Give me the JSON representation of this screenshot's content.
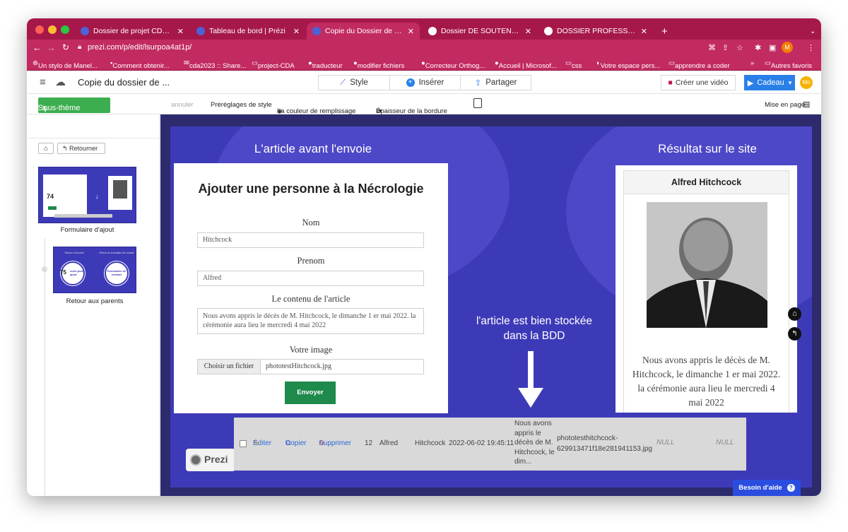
{
  "browser": {
    "tabs": [
      {
        "label": "Dossier de projet CDA bastien",
        "active": false,
        "favicon_color": "#4a63d6"
      },
      {
        "label": "Tableau de bord | Prézi",
        "active": false,
        "favicon_color": "#4a63d6"
      },
      {
        "label": "Copie du Dossier de projet CD:",
        "active": true,
        "favicon_color": "#4a63d6"
      },
      {
        "label": "Dossier DE SOUTENANCE PO",
        "active": false,
        "favicon_color": "#ffffff"
      },
      {
        "label": "DOSSIER PROFESSIONNEL (DI",
        "active": false,
        "favicon_color": "#ffffff"
      }
    ],
    "url": "prezi.com/p/edit/lsurpoa4at1p/",
    "bookmarks": [
      "Un stylo de Manel...",
      "Comment obtenir...",
      "cda2023 :: Share...",
      "project-CDA",
      "traducteur",
      "modifier fichiers",
      "Correcteur Orthog...",
      "Accueil | Microsof...",
      "css",
      "Votre espace pers...",
      "apprendre a coder",
      "»",
      "Autres favoris"
    ],
    "profile_initial": "M"
  },
  "app": {
    "doc_title": "Copie du dossier de ...",
    "style_label": "Style",
    "insert_label": "Insérer",
    "share_label": "Partager",
    "video_label": "Créer une vidéo",
    "gift_label": "Cadeau",
    "user_initials": "Mo"
  },
  "toolbar": {
    "undo": "annuler",
    "presets": "Préréglages de style",
    "fill": "La couleur de remplissage",
    "border": "Épaisseur de la bordure",
    "layout": "Mise en page"
  },
  "sidebar": {
    "add_topic": "Sous-thème",
    "back": "Retourner",
    "topics": [
      {
        "label": "Formulaire d'ajout",
        "number": "74"
      },
      {
        "label": "Retour aux parents",
        "number": "75",
        "thumb_left": "Retour à l'accueil",
        "thumb_left_bubble": "cuirs pour ajout",
        "thumb_right": "Retour au formulaire de contact",
        "thumb_right_bubble": "Formulaire de contact"
      }
    ]
  },
  "slide": {
    "left_title": "L'article avant l'envoie",
    "right_title": "Résultat sur le site",
    "middle_text": "l'article est bien stockée dans la BDD",
    "form": {
      "heading": "Ajouter une personne à la Nécrologie",
      "nom_label": "Nom",
      "nom_value": "Hitchcock",
      "prenom_label": "Prenom",
      "prenom_value": "Alfred",
      "content_label": "Le contenu de l'article",
      "content_value": "Nous avons appris le décès de M. Hitchcock, le dimanche 1 er mai 2022. la cérémonie aura lieu le mercredi 4 mai 2022",
      "image_label": "Votre image",
      "file_button": "Choisir un fichier",
      "file_name": "phototestHitchcock.jpg",
      "submit": "Envoyer"
    },
    "result": {
      "name": "Alfred Hitchcock",
      "text": "Nous avons appris le décès de M. Hitchcock, le dimanche 1 er mai 2022. la cérémonie aura lieu le mercredi 4 mai 2022"
    },
    "db_row": {
      "edit": "Éditer",
      "copy": "Copier",
      "delete": "Supprimer",
      "id": "12",
      "prenom": "Alfred",
      "nom": "Hitchcock",
      "date": "2022-06-02 19:45:11",
      "content": "Nous avons appris le décès de M. Hitchcock, le dim...",
      "photo": "phototesthitchcock-629913471f18e281941153.jpg",
      "null1": "NULL",
      "null2": "NULL"
    },
    "prezi_logo": "Prezi"
  },
  "help": "Besoin d'aide",
  "colors": {
    "tab_bg": "#a6184a",
    "chrome": "#c22a62",
    "slide": "#3d3ab8",
    "green": "#3dae4f",
    "blue": "#2a80e8"
  }
}
